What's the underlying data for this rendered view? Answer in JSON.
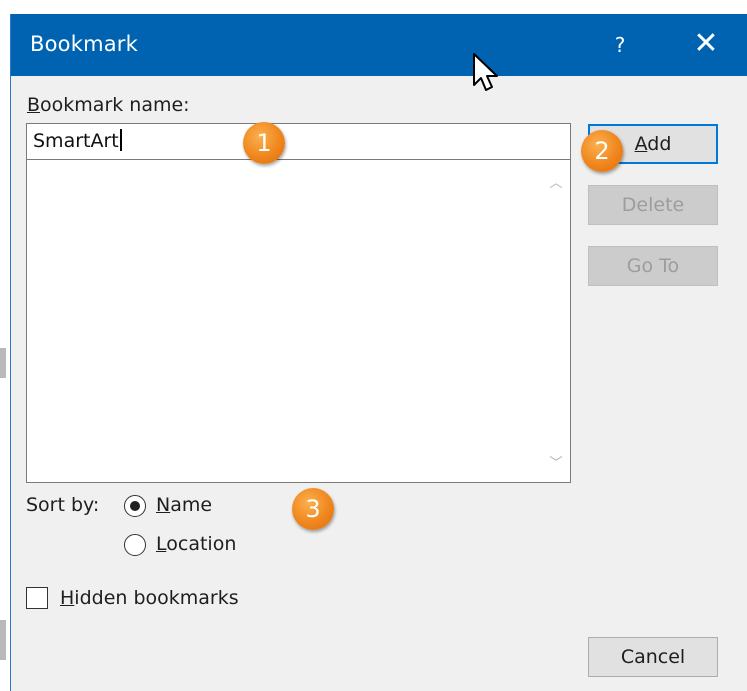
{
  "dialog": {
    "title": "Bookmark",
    "help_label": "?",
    "close_label": "✕"
  },
  "form": {
    "name_label_underlined": "B",
    "name_label_rest": "ookmark name:",
    "name_value": "SmartArt",
    "sort_label": "Sort by:",
    "sort_options": [
      {
        "underlined": "N",
        "rest": "ame",
        "selected": true
      },
      {
        "underlined": "L",
        "rest": "ocation",
        "selected": false
      }
    ],
    "hidden_underlined": "H",
    "hidden_rest": "idden bookmarks",
    "hidden_checked": false
  },
  "buttons": {
    "add_underlined": "A",
    "add_rest": "dd",
    "delete": "Delete",
    "goto": "Go To",
    "cancel": "Cancel"
  },
  "list": {
    "scroll_up": "︿",
    "scroll_down": "﹀"
  },
  "callouts": [
    "1",
    "2",
    "3"
  ],
  "colors": {
    "titlebar": "#0063b1",
    "accent": "#0078d7",
    "callout": "#f0861d"
  }
}
